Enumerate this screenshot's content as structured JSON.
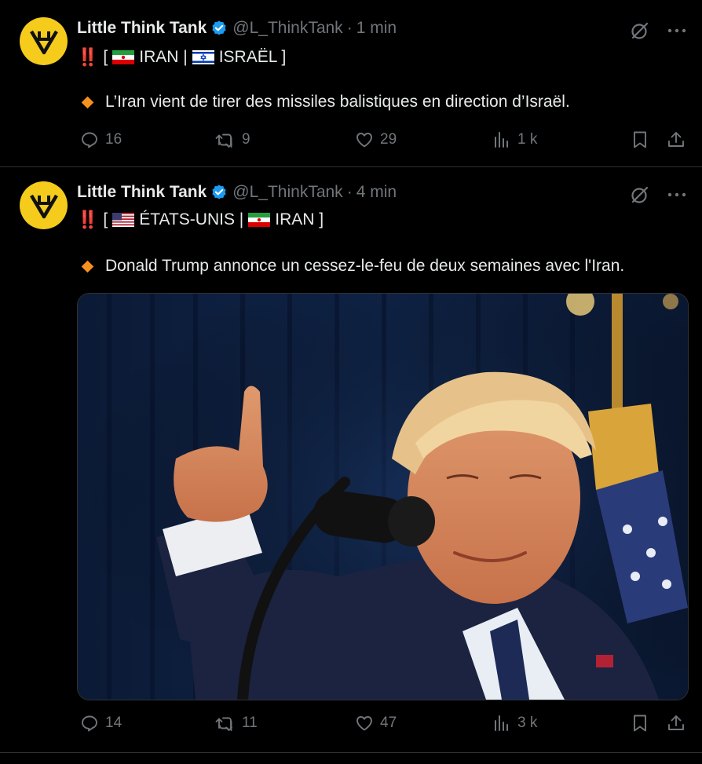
{
  "colors": {
    "background": "#000000",
    "text": "#e7e9ea",
    "muted": "#71767b",
    "verified": "#1d9bf0",
    "avatar": "#f5cc1c",
    "diamond": "#f6901e",
    "alert": "#f4212e"
  },
  "tweets": [
    {
      "author": "Little Think Tank",
      "handle": "@L_ThinkTank",
      "separator": "·",
      "time": "1 min",
      "alert_icon": "‼️",
      "tag_open": "[",
      "tag_one": "IRAN |",
      "tag_two": "ISRAËL ]",
      "text": "L’Iran vient de tirer des missiles balistiques en direction d’Israël.",
      "replies": "16",
      "reposts": "9",
      "likes": "29",
      "views": "1 k",
      "icons": [
        "grok-icon",
        "more-icon",
        "reply-icon",
        "repost-icon",
        "like-icon",
        "views-icon",
        "bookmark-icon",
        "share-icon"
      ]
    },
    {
      "author": "Little Think Tank",
      "handle": "@L_ThinkTank",
      "separator": "·",
      "time": "4 min",
      "alert_icon": "‼️",
      "tag_open": "[",
      "tag_one": "ÉTATS-UNIS |",
      "tag_two": "IRAN ]",
      "text": "Donald Trump annonce un cessez-le-feu de deux semaines avec l'Iran.",
      "media": "photo",
      "replies": "14",
      "reposts": "11",
      "likes": "47",
      "views": "3 k",
      "icons": [
        "grok-icon",
        "more-icon",
        "reply-icon",
        "repost-icon",
        "like-icon",
        "views-icon",
        "bookmark-icon",
        "share-icon"
      ]
    }
  ]
}
